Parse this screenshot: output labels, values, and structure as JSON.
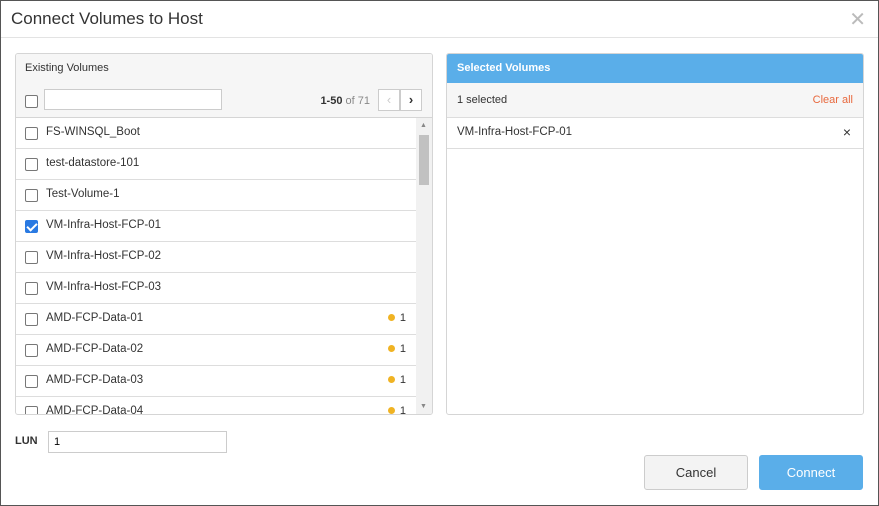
{
  "title": "Connect Volumes to Host",
  "existing": {
    "label": "Existing Volumes",
    "search_value": "",
    "range": "1-50",
    "of_total": "of 71",
    "items": [
      {
        "name": "FS-WINSQL_Boot",
        "checked": false,
        "badge": ""
      },
      {
        "name": "test-datastore-101",
        "checked": false,
        "badge": ""
      },
      {
        "name": "Test-Volume-1",
        "checked": false,
        "badge": ""
      },
      {
        "name": "VM-Infra-Host-FCP-01",
        "checked": true,
        "badge": ""
      },
      {
        "name": "VM-Infra-Host-FCP-02",
        "checked": false,
        "badge": ""
      },
      {
        "name": "VM-Infra-Host-FCP-03",
        "checked": false,
        "badge": ""
      },
      {
        "name": "AMD-FCP-Data-01",
        "checked": false,
        "badge": "1"
      },
      {
        "name": "AMD-FCP-Data-02",
        "checked": false,
        "badge": "1"
      },
      {
        "name": "AMD-FCP-Data-03",
        "checked": false,
        "badge": "1"
      },
      {
        "name": "AMD-FCP-Data-04",
        "checked": false,
        "badge": "1"
      }
    ]
  },
  "selected": {
    "label": "Selected Volumes",
    "count": "1 selected",
    "clear_all": "Clear all",
    "items": [
      "VM-Infra-Host-FCP-01"
    ]
  },
  "lun": {
    "label": "LUN",
    "value": "1"
  },
  "buttons": {
    "cancel": "Cancel",
    "connect": "Connect"
  }
}
